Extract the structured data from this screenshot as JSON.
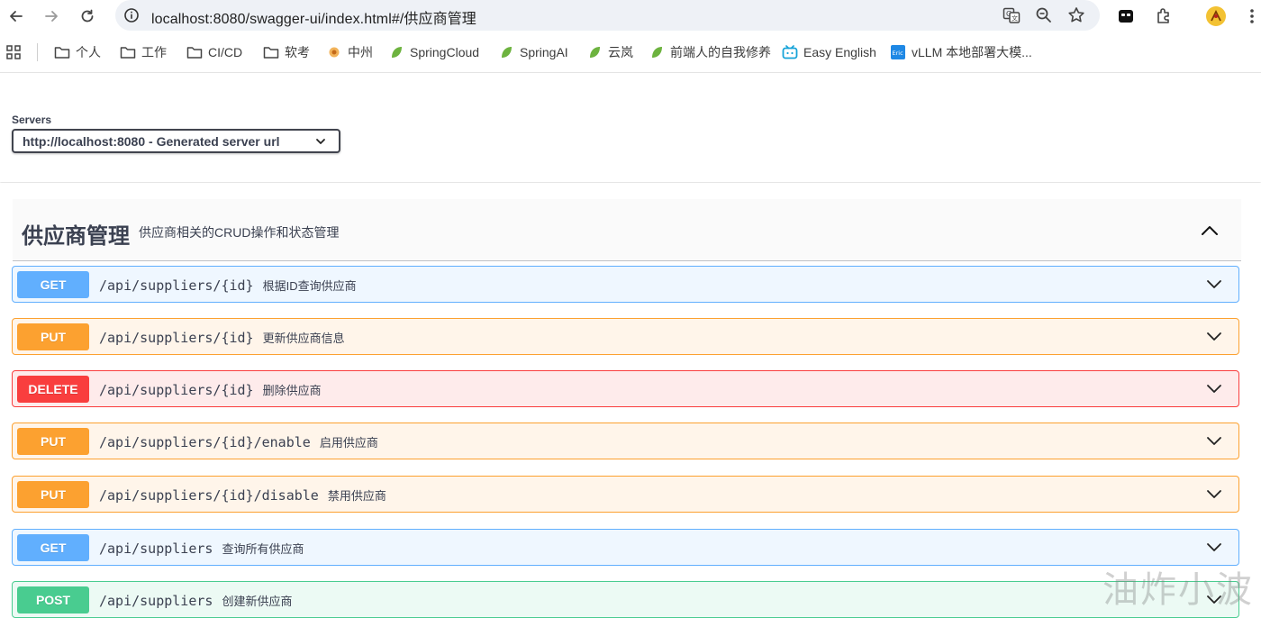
{
  "browser": {
    "url": "localhost:8080/swagger-ui/index.html#/供应商管理"
  },
  "bookmarks": [
    {
      "label": "个人",
      "icon": "folder-icon"
    },
    {
      "label": "工作",
      "icon": "folder-icon"
    },
    {
      "label": "CI/CD",
      "icon": "folder-icon"
    },
    {
      "label": "软考",
      "icon": "folder-icon"
    },
    {
      "label": "中州",
      "icon": "site-icon"
    },
    {
      "label": "SpringCloud",
      "icon": "leaf-icon"
    },
    {
      "label": "SpringAI",
      "icon": "leaf-icon"
    },
    {
      "label": "云岚",
      "icon": "leaf-icon"
    },
    {
      "label": "前端人的自我修养",
      "icon": "leaf-icon"
    },
    {
      "label": "Easy English",
      "icon": "bilibili-icon"
    },
    {
      "label": "vLLM 本地部署大模...",
      "icon": "eric-icon"
    }
  ],
  "servers": {
    "label": "Servers",
    "selected": "http://localhost:8080 - Generated server url"
  },
  "tag": {
    "title": "供应商管理",
    "description": "供应商相关的CRUD操作和状态管理"
  },
  "operations": [
    {
      "method": "GET",
      "path": "/api/suppliers/{id}",
      "summary": "根据ID查询供应商"
    },
    {
      "method": "PUT",
      "path": "/api/suppliers/{id}",
      "summary": "更新供应商信息"
    },
    {
      "method": "DELETE",
      "path": "/api/suppliers/{id}",
      "summary": "删除供应商"
    },
    {
      "method": "PUT",
      "path": "/api/suppliers/{id}/enable",
      "summary": "启用供应商"
    },
    {
      "method": "PUT",
      "path": "/api/suppliers/{id}/disable",
      "summary": "禁用供应商"
    },
    {
      "method": "GET",
      "path": "/api/suppliers",
      "summary": "查询所有供应商"
    },
    {
      "method": "POST",
      "path": "/api/suppliers",
      "summary": "创建新供应商"
    }
  ],
  "watermark": "油炸小波",
  "colors": {
    "get": "#61affe",
    "put": "#fca130",
    "delete": "#f93e3e",
    "post": "#49cc90"
  }
}
